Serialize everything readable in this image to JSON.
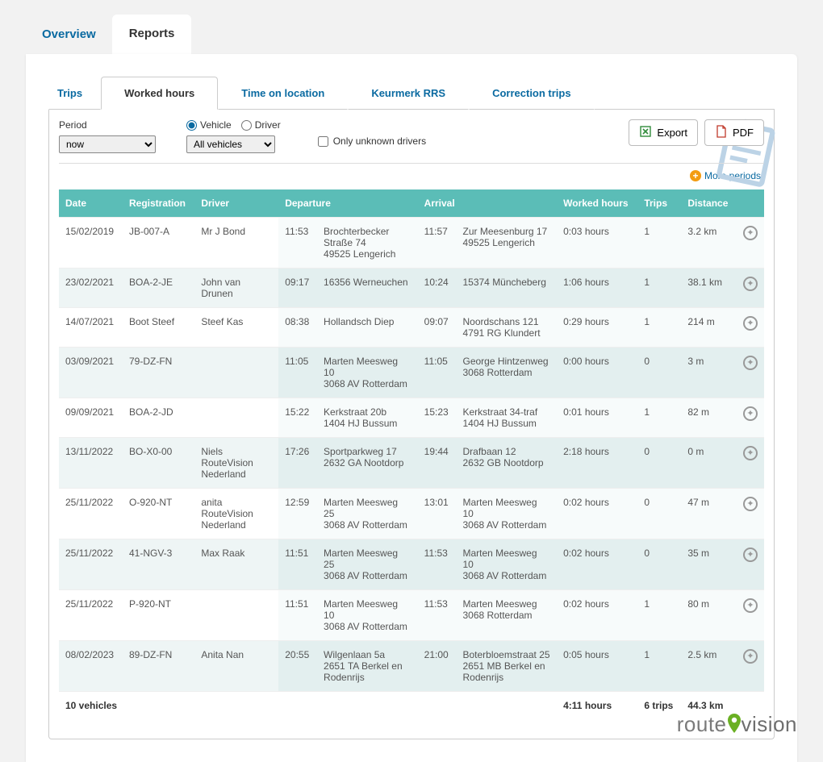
{
  "topTabs": {
    "overview": "Overview",
    "reports": "Reports"
  },
  "subTabs": {
    "trips": "Trips",
    "worked": "Worked hours",
    "time": "Time on location",
    "keurmerk": "Keurmerk RRS",
    "correction": "Correction trips"
  },
  "filters": {
    "periodLabel": "Period",
    "periodValue": "now",
    "groupVehicle": "Vehicle",
    "groupDriver": "Driver",
    "vehiclesValue": "All vehicles",
    "unknownLabel": "Only unknown drivers"
  },
  "buttons": {
    "export": "Export",
    "pdf": "PDF"
  },
  "morePeriods": "More periods",
  "headers": {
    "date": "Date",
    "reg": "Registration",
    "driver": "Driver",
    "dep": "Departure",
    "arr": "Arrival",
    "worked": "Worked hours",
    "trips": "Trips",
    "dist": "Distance"
  },
  "rows": [
    {
      "date": "15/02/2019",
      "reg": "JB-007-A",
      "driver": "Mr J Bond",
      "depTime": "11:53",
      "depAddr": [
        "Brochterbecker Straße 74",
        "49525 Lengerich"
      ],
      "arrTime": "11:57",
      "arrAddr": [
        "Zur Meesenburg 17",
        "49525 Lengerich"
      ],
      "worked": "0:03 hours",
      "trips": "1",
      "dist": "3.2 km"
    },
    {
      "date": "23/02/2021",
      "reg": "BOA-2-JE",
      "driver": "John van Drunen",
      "depTime": "09:17",
      "depAddr": [
        "",
        "16356 Werneuchen"
      ],
      "arrTime": "10:24",
      "arrAddr": [
        "",
        "15374 Müncheberg"
      ],
      "worked": "1:06 hours",
      "trips": "1",
      "dist": "38.1 km"
    },
    {
      "date": "14/07/2021",
      "reg": "Boot Steef",
      "driver": "Steef Kas",
      "depTime": "08:38",
      "depAddr": [
        "Hollandsch Diep"
      ],
      "arrTime": "09:07",
      "arrAddr": [
        "Noordschans 121",
        "4791 RG Klundert"
      ],
      "worked": "0:29 hours",
      "trips": "1",
      "dist": "214 m"
    },
    {
      "date": "03/09/2021",
      "reg": "79-DZ-FN",
      "driver": "",
      "depTime": "11:05",
      "depAddr": [
        "Marten Meesweg 10",
        "3068 AV Rotterdam"
      ],
      "arrTime": "11:05",
      "arrAddr": [
        "George Hintzenweg",
        "3068 Rotterdam"
      ],
      "worked": "0:00 hours",
      "trips": "0",
      "dist": "3 m"
    },
    {
      "date": "09/09/2021",
      "reg": "BOA-2-JD",
      "driver": "",
      "depTime": "15:22",
      "depAddr": [
        "Kerkstraat 20b",
        "1404 HJ Bussum"
      ],
      "arrTime": "15:23",
      "arrAddr": [
        "Kerkstraat 34-traf",
        "1404 HJ Bussum"
      ],
      "worked": "0:01 hours",
      "trips": "1",
      "dist": "82 m"
    },
    {
      "date": "13/11/2022",
      "reg": "BO-X0-00",
      "driver": "Niels RouteVision Nederland",
      "depTime": "17:26",
      "depAddr": [
        "Sportparkweg 17",
        "2632 GA Nootdorp"
      ],
      "arrTime": "19:44",
      "arrAddr": [
        "Drafbaan 12",
        "2632 GB Nootdorp"
      ],
      "worked": "2:18 hours",
      "trips": "0",
      "dist": "0 m"
    },
    {
      "date": "25/11/2022",
      "reg": "O-920-NT",
      "driver": "anita RouteVision Nederland",
      "depTime": "12:59",
      "depAddr": [
        "Marten Meesweg 25",
        "3068 AV Rotterdam"
      ],
      "arrTime": "13:01",
      "arrAddr": [
        "Marten Meesweg 10",
        "3068 AV Rotterdam"
      ],
      "worked": "0:02 hours",
      "trips": "0",
      "dist": "47 m"
    },
    {
      "date": "25/11/2022",
      "reg": "41-NGV-3",
      "driver": "Max Raak",
      "depTime": "11:51",
      "depAddr": [
        "Marten Meesweg 25",
        "3068 AV Rotterdam"
      ],
      "arrTime": "11:53",
      "arrAddr": [
        "Marten Meesweg 10",
        "3068 AV Rotterdam"
      ],
      "worked": "0:02 hours",
      "trips": "0",
      "dist": "35 m"
    },
    {
      "date": "25/11/2022",
      "reg": "P-920-NT",
      "driver": "",
      "depTime": "11:51",
      "depAddr": [
        "Marten Meesweg 10",
        "3068 AV Rotterdam"
      ],
      "arrTime": "11:53",
      "arrAddr": [
        "Marten Meesweg",
        "3068 Rotterdam"
      ],
      "worked": "0:02 hours",
      "trips": "1",
      "dist": "80 m"
    },
    {
      "date": "08/02/2023",
      "reg": "89-DZ-FN",
      "driver": "Anita Nan",
      "depTime": "20:55",
      "depAddr": [
        "Wilgenlaan 5a",
        "2651 TA Berkel en Rodenrijs"
      ],
      "arrTime": "21:00",
      "arrAddr": [
        "Boterbloemstraat 25",
        "2651 MB Berkel en Rodenrijs"
      ],
      "worked": "0:05 hours",
      "trips": "1",
      "dist": "2.5 km"
    }
  ],
  "summary": {
    "vehicles": "10 vehicles",
    "worked": "4:11 hours",
    "trips": "6 trips",
    "dist": "44.3 km"
  },
  "logo": {
    "part1": "route",
    "part2": "vision"
  }
}
